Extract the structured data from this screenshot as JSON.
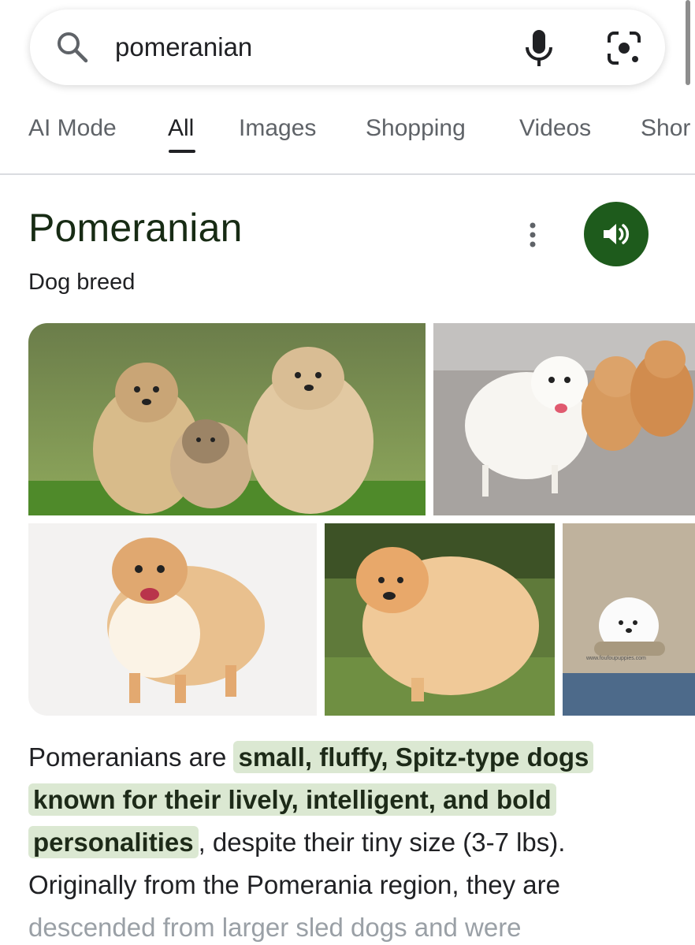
{
  "search": {
    "query": "pomeranian",
    "icons": [
      "search-icon",
      "mic-icon",
      "lens-icon"
    ]
  },
  "tabs": [
    {
      "label": "AI Mode",
      "active": false
    },
    {
      "label": "All",
      "active": true
    },
    {
      "label": "Images",
      "active": false
    },
    {
      "label": "Shopping",
      "active": false
    },
    {
      "label": "Videos",
      "active": false
    },
    {
      "label": "Shor",
      "active": false
    }
  ],
  "knowledge_panel": {
    "title": "Pomeranian",
    "subtitle": "Dog breed",
    "accent_color": "#1e5b1c",
    "images": [
      {
        "watermark": ""
      },
      {
        "watermark": ""
      },
      {
        "watermark": ""
      },
      {
        "watermark": ""
      },
      {
        "watermark": "www.foufoupuppies.com"
      }
    ],
    "description": {
      "part1": "Pomeranians are ",
      "highlight": "small, fluffy, Spitz-type dogs known for their lively, intelligent, and bold personalities",
      "part2": ", despite their tiny size (3-7 lbs). Originally from the Pomerania region, they are ",
      "faded": "descended from larger sled dogs and were"
    },
    "highlight_color": "#dbe8d2"
  }
}
